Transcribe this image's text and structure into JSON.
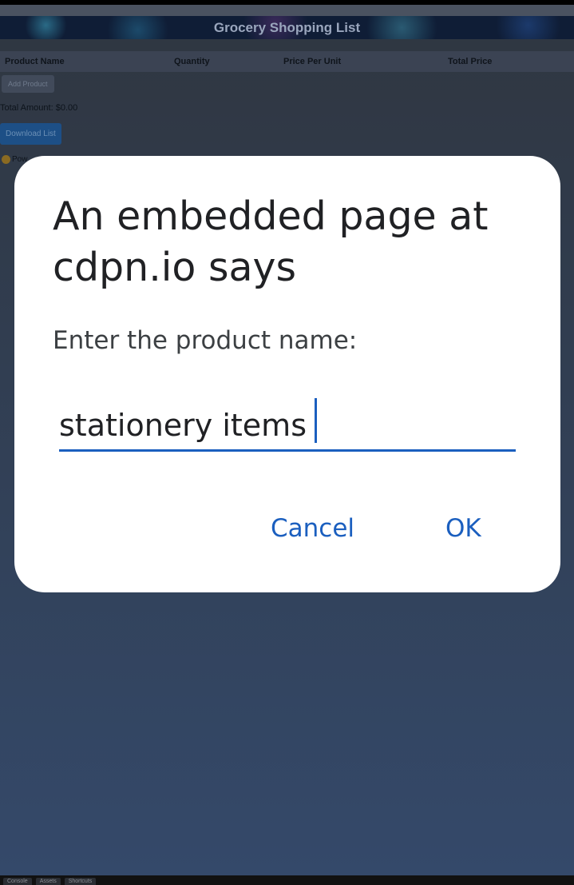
{
  "page": {
    "title": "Grocery Shopping List",
    "table_headers": [
      "Product Name",
      "Quantity",
      "Price Per Unit",
      "Total Price"
    ],
    "add_button": "Add Product",
    "total_amount": "Total Amount: $0.00",
    "download_button": "Download List",
    "powered_text": "Pow"
  },
  "dialog": {
    "title": "An embedded page at cdpn.io says",
    "message": "Enter the product name:",
    "input_value": "stationery items",
    "cancel_label": "Cancel",
    "ok_label": "OK"
  },
  "bottom_tabs": [
    "Console",
    "Assets",
    "Shortcuts"
  ],
  "colors": {
    "accent": "#1b5fbf",
    "dialog_bg": "#ffffff"
  }
}
